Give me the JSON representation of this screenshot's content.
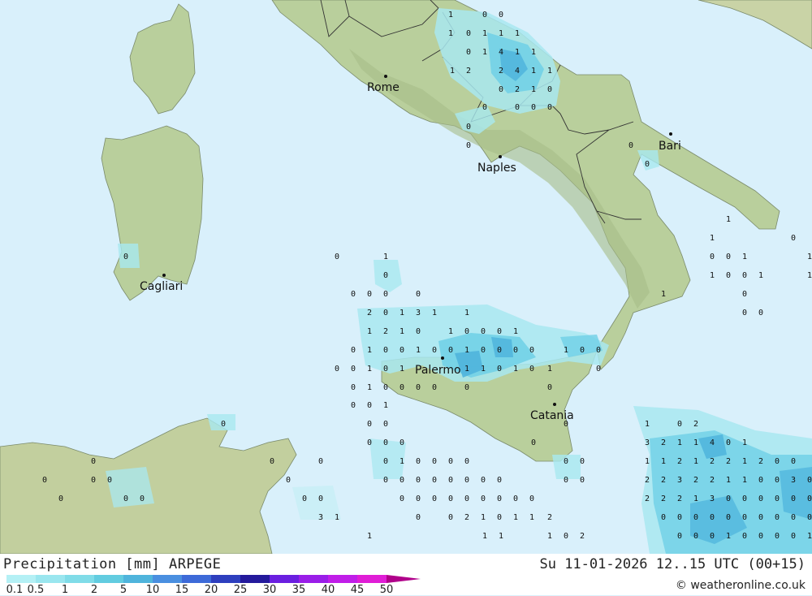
{
  "title": "Precipitation [mm] ARPEGE",
  "run_info": "Su 11-01-2026 12..15 UTC (00+15)",
  "credit": "© weatheronline.co.uk",
  "cities": [
    "Rome",
    "Naples",
    "Bari",
    "Cagliari",
    "Palermo",
    "Catania"
  ],
  "legend": {
    "ticks": [
      "0.1",
      "0.5",
      "1",
      "2",
      "5",
      "10",
      "15",
      "20",
      "25",
      "30",
      "35",
      "40",
      "45",
      "50"
    ],
    "colors": [
      "#b4f0f5",
      "#9ae6ef",
      "#80dce8",
      "#62cce0",
      "#4fb4dc",
      "#4a8fe0",
      "#3d6ad8",
      "#2e3fbe",
      "#241a9c",
      "#6a1fe0",
      "#9a1ee8",
      "#c01ee8",
      "#e01ed6",
      "#b0008a"
    ]
  },
  "colors": {
    "sea": "#d9f0fb",
    "land": "#b9cf9c",
    "precip_light": "#a8e8f0",
    "precip_medium": "#6fd0e6",
    "precip_heavy": "#4fb4dc"
  },
  "values": [
    "1",
    "0",
    "0",
    "1",
    "0",
    "1",
    "1",
    "1",
    "0",
    "1",
    "4",
    "1",
    "1",
    "1",
    "2",
    "2",
    "4",
    "1",
    "1",
    "0",
    "2",
    "1",
    "0",
    "0",
    "0",
    "0",
    "0",
    "0",
    "0",
    "0",
    "0",
    "1",
    "1",
    "0",
    "0",
    "0",
    "1",
    "1",
    "1",
    "0",
    "0",
    "1",
    "1",
    "0",
    "0",
    "0",
    "1",
    "0",
    "1",
    "0",
    "0",
    "0",
    "0",
    "0",
    "2",
    "0",
    "1",
    "3",
    "1",
    "1",
    "1",
    "2",
    "1",
    "0",
    "1",
    "0",
    "0",
    "0",
    "1",
    "0",
    "1",
    "0",
    "0",
    "1",
    "0",
    "0",
    "1",
    "0",
    "0",
    "0",
    "0",
    "1",
    "0",
    "0",
    "0",
    "0",
    "1",
    "0",
    "1",
    "1",
    "1",
    "0",
    "1",
    "0",
    "1",
    "0",
    "0",
    "1",
    "0",
    "0",
    "0",
    "0",
    "0",
    "0",
    "0",
    "0",
    "1",
    "0",
    "0",
    "0",
    "0",
    "0",
    "0",
    "0",
    "0",
    "1",
    "0",
    "0",
    "0",
    "0",
    "0",
    "0",
    "0",
    "0",
    "0",
    "0",
    "0",
    "0",
    "0",
    "0",
    "0",
    "0",
    "0",
    "0",
    "0",
    "0",
    "0",
    "0",
    "0",
    "0",
    "0",
    "0",
    "0",
    "0",
    "0",
    "0",
    "0",
    "0",
    "0",
    "0",
    "0",
    "0",
    "0",
    "3",
    "1",
    "0",
    "0",
    "2",
    "1",
    "0",
    "1",
    "1",
    "2",
    "1",
    "1",
    "1",
    "1",
    "0",
    "2",
    "1",
    "0",
    "2",
    "3",
    "2",
    "1",
    "1",
    "4",
    "0",
    "1",
    "1",
    "1",
    "2",
    "1",
    "2",
    "2",
    "1",
    "2",
    "0",
    "0",
    "2",
    "2",
    "3",
    "2",
    "2",
    "1",
    "1",
    "0",
    "0",
    "3",
    "0",
    "2",
    "2",
    "2",
    "1",
    "3",
    "0",
    "0",
    "0",
    "0",
    "0",
    "0",
    "0",
    "0",
    "0",
    "0",
    "0",
    "0",
    "0",
    "0",
    "0",
    "0",
    "0",
    "0",
    "0",
    "1",
    "0",
    "0",
    "0",
    "0",
    "1",
    "1",
    "0",
    "0",
    "0"
  ]
}
